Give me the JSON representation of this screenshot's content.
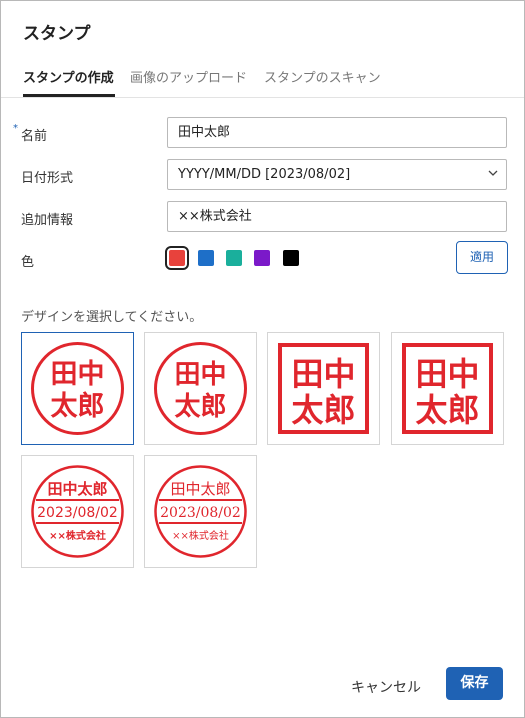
{
  "dialog": {
    "title": "スタンプ"
  },
  "tabs": [
    {
      "label": "スタンプの作成",
      "active": true
    },
    {
      "label": "画像のアップロード",
      "active": false
    },
    {
      "label": "スタンプのスキャン",
      "active": false
    }
  ],
  "form": {
    "name": {
      "required_mark": "*",
      "label": "名前",
      "value": "田中太郎"
    },
    "date_format": {
      "label": "日付形式",
      "value": "YYYY/MM/DD [2023/08/02]"
    },
    "extra_info": {
      "label": "追加情報",
      "value": "××株式会社"
    },
    "color": {
      "label": "色",
      "selected": 0,
      "swatches": [
        "#e8423c",
        "#1e6fc8",
        "#1aaf9c",
        "#7b19c9",
        "#000000"
      ]
    },
    "apply_label": "適用"
  },
  "designs": {
    "caption": "デザインを選択してください。",
    "selected": 0,
    "name_line1": "田中",
    "name_line2": "太郎",
    "name_full": "田中太郎",
    "date": "2023/08/02",
    "company": "××株式会社",
    "stamp_color": "#e0262d"
  },
  "footer": {
    "cancel_label": "キャンセル",
    "save_label": "保存"
  },
  "colors": {
    "accent": "#1f62b4"
  }
}
